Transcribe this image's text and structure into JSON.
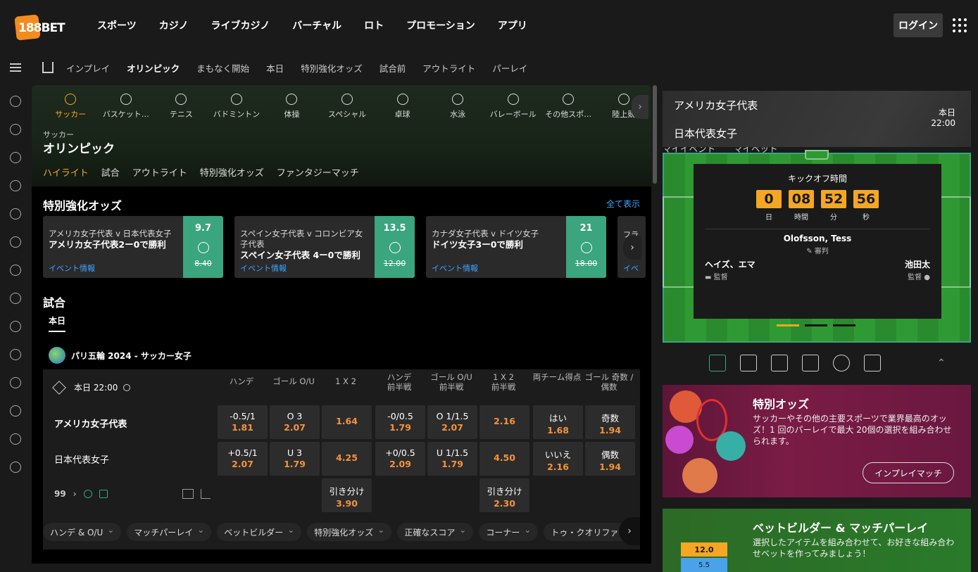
{
  "brand": {
    "logo": "188BET"
  },
  "main_nav": [
    "スポーツ",
    "カジノ",
    "ライブカジノ",
    "バーチャル",
    "ロト",
    "プロモーション",
    "アプリ"
  ],
  "login_label": "ログイン",
  "sub_nav": {
    "items": [
      "インプレイ",
      "オリンピック",
      "まもなく開始",
      "本日",
      "特別強化オッズ",
      "試合前",
      "アウトライト",
      "パーレイ"
    ],
    "active": "オリンピック",
    "right": [
      "マイイベント",
      "マイベット"
    ]
  },
  "sports_bar": [
    {
      "label": "サッカー",
      "icon": "soccer-icon"
    },
    {
      "label": "バスケット…",
      "icon": "basketball-icon"
    },
    {
      "label": "テニス",
      "icon": "tennis-icon"
    },
    {
      "label": "バドミントン",
      "icon": "badminton-icon"
    },
    {
      "label": "体操",
      "icon": "gymnastics-icon"
    },
    {
      "label": "スペシャル",
      "icon": "trophy-icon"
    },
    {
      "label": "卓球",
      "icon": "table-tennis-icon"
    },
    {
      "label": "水泳",
      "icon": "swimming-icon"
    },
    {
      "label": "バレーボール",
      "icon": "volleyball-icon"
    },
    {
      "label": "その他スポ…",
      "icon": "plus-icon"
    },
    {
      "label": "陸上競",
      "icon": "athletics-icon"
    }
  ],
  "hero": {
    "crumb": "サッカー",
    "title": "オリンピック",
    "tabs": [
      "ハイライト",
      "試合",
      "アウトライト",
      "特別強化オッズ",
      "ファンタジーマッチ"
    ]
  },
  "boost_section": {
    "title": "特別強化オッズ",
    "see_all": "全て表示",
    "cards": [
      {
        "match": "アメリカ女子代表 v 日本代表女子",
        "bet": "アメリカ女子代表2ー0で勝利",
        "odd": "9.7",
        "old": "8.40",
        "info": "イベント情報"
      },
      {
        "match": "スペイン女子代表 v コロンビア女子代表",
        "bet": "スペイン女子代表 4ー0で勝利",
        "odd": "13.5",
        "old": "12.00",
        "info": "イベント情報"
      },
      {
        "match": "カナダ女子代表 v ドイツ女子",
        "bet": "ドイツ女子3ー0で勝利",
        "odd": "21",
        "old": "18.00",
        "info": "イベント情報"
      }
    ],
    "partial": {
      "match": "フラ",
      "info": "イベ"
    }
  },
  "matches_section": {
    "title": "試合",
    "date_tab": "本日",
    "competition": "パリ五輪 2024 - サッカー女子"
  },
  "match": {
    "time": "本日 22:00",
    "columns": [
      "ハンデ",
      "ゴール O/U",
      "1 X 2",
      "ハンデ\n前半戦",
      "ゴール O/U\n前半戦",
      "1 X 2\n前半戦",
      "両チーム得点",
      "ゴール 奇数 / 偶数"
    ],
    "home": {
      "name": "アメリカ女子代表",
      "cells": [
        {
          "l": "-0.5/1",
          "o": "1.81"
        },
        {
          "l": "O 3",
          "o": "2.07"
        },
        {
          "l": "",
          "o": "1.64"
        },
        {
          "l": "-0/0.5",
          "o": "1.79"
        },
        {
          "l": "O 1/1.5",
          "o": "2.07"
        },
        {
          "l": "",
          "o": "2.16"
        },
        {
          "l": "はい",
          "o": "1.68"
        },
        {
          "l": "奇数",
          "o": "1.94"
        }
      ]
    },
    "away": {
      "name": "日本代表女子",
      "cells": [
        {
          "l": "+0.5/1",
          "o": "2.07"
        },
        {
          "l": "U 3",
          "o": "1.79"
        },
        {
          "l": "",
          "o": "4.25"
        },
        {
          "l": "+0/0.5",
          "o": "2.09"
        },
        {
          "l": "U 1/1.5",
          "o": "1.79"
        },
        {
          "l": "",
          "o": "4.50"
        },
        {
          "l": "いいえ",
          "o": "2.16"
        },
        {
          "l": "偶数",
          "o": "1.94"
        }
      ]
    },
    "draw": {
      "label": "引き分け",
      "ft": "3.90",
      "ht": "2.30"
    },
    "more_count": "99",
    "chips": [
      "ハンデ & O/U",
      "マッチパーレイ",
      "ベットビルダー",
      "特別強化オッズ",
      "正確なスコア",
      "コーナー",
      "トゥ・クオリファ"
    ]
  },
  "right_panel": {
    "team_a": "アメリカ女子代表",
    "team_b": "日本代表女子",
    "date": "本日",
    "time": "22:00",
    "kickoff_label": "キックオフ時間",
    "countdown": [
      {
        "n": "0",
        "l": "日"
      },
      {
        "n": "08",
        "l": "時間"
      },
      {
        "n": "52",
        "l": "分"
      },
      {
        "n": "56",
        "l": "秒"
      }
    ],
    "referee": "Olofsson, Tess",
    "referee_label": "審判",
    "coach_home": "ヘイズ、エマ",
    "coach_away": "池田太",
    "coach_label": "監督"
  },
  "promo_odds": {
    "title": "特別オッズ",
    "desc": "サッカーやその他の主要スポーツで業界最高のオッズ！1 回のパーレイで最大 20個の選択を組み合わせられます。",
    "button": "インプレイマッチ"
  },
  "promo_builder": {
    "title": "ベットビルダー & マッチパーレイ",
    "desc": "選択したアイテムを組み合わせて、お好きな組み合わせベットを作ってみましょう！",
    "card_top": "12.0",
    "card_bottom": "5.5"
  },
  "colors": {
    "accent": "#f5a623",
    "green": "#3aa57e",
    "link": "#3ea6ff",
    "odds": "#f5933a"
  }
}
